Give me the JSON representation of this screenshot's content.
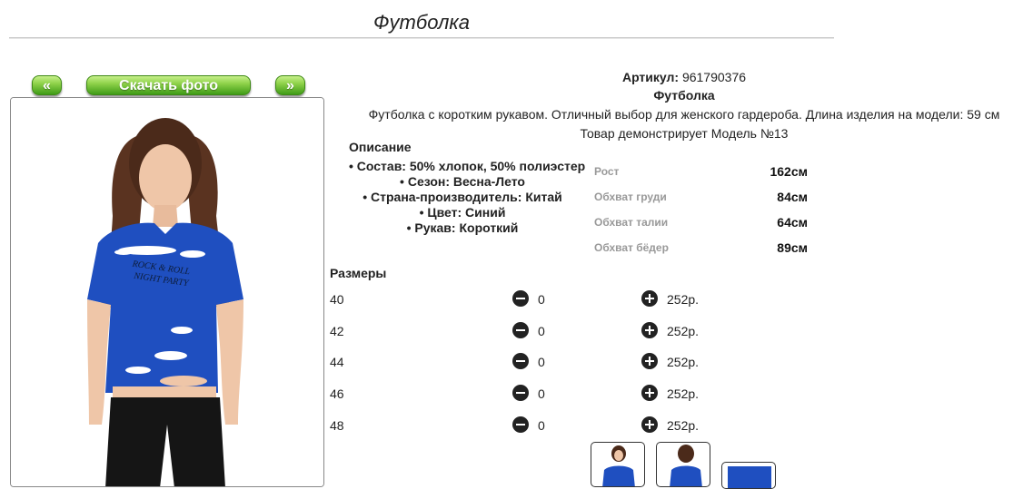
{
  "header": {
    "title": "Футболка"
  },
  "gallery": {
    "prev_label": "«",
    "download_label": "Скачать фото",
    "next_label": "»",
    "print_text_line1": "ROCK & ROLL",
    "print_text_line2": "NIGHT PARTY"
  },
  "product": {
    "article_label": "Артикул:",
    "article_value": "961790376",
    "name": "Футболка",
    "description": "Футболка с коротким рукавом. Отличный выбор для женского гардероба. Длина изделия на модели: 59 см",
    "model_note": "Товар демонстрирует Модель №13"
  },
  "description_section": {
    "title": "Описание",
    "items": [
      "Состав: 50% хлопок, 50% полиэстер",
      "Сезон: Весна-Лето",
      "Страна-производитель: Китай",
      "Цвет: Синий",
      "Рукав: Короткий"
    ]
  },
  "measurements": [
    {
      "label": "Рост",
      "value": "162см"
    },
    {
      "label": "Обхват груди",
      "value": "84см"
    },
    {
      "label": "Обхват талии",
      "value": "64см"
    },
    {
      "label": "Обхват бёдер",
      "value": "89см"
    }
  ],
  "sizes": {
    "title": "Размеры",
    "rows": [
      {
        "size": "40",
        "qty": "0",
        "price": "252р."
      },
      {
        "size": "42",
        "qty": "0",
        "price": "252р."
      },
      {
        "size": "44",
        "qty": "0",
        "price": "252р."
      },
      {
        "size": "46",
        "qty": "0",
        "price": "252р."
      },
      {
        "size": "48",
        "qty": "0",
        "price": "252р."
      }
    ]
  },
  "colors": {
    "shirt": "#1f4fc0",
    "button_green": "#5db52a"
  }
}
